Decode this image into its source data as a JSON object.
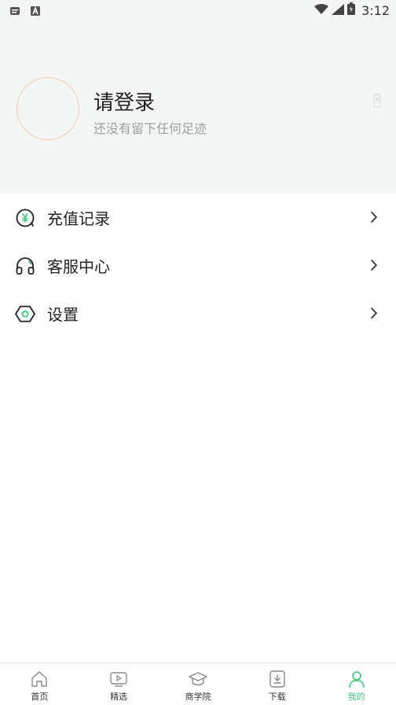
{
  "status_bar": {
    "time": "3:12",
    "left_icons": [
      "notification-icon",
      "a-icon"
    ],
    "right_icons": [
      "wifi-icon",
      "signal-icon",
      "battery-icon"
    ]
  },
  "profile": {
    "title": "请登录",
    "subtitle": "还没有留下任何足迹"
  },
  "menu": {
    "items": [
      {
        "label": "充值记录",
        "icon": "recharge-icon"
      },
      {
        "label": "客服中心",
        "icon": "headset-icon"
      },
      {
        "label": "设置",
        "icon": "settings-icon"
      }
    ]
  },
  "tabbar": {
    "active_color": "#3cc47a",
    "tabs": [
      {
        "label": "首页",
        "icon": "home-icon"
      },
      {
        "label": "精选",
        "icon": "video-icon"
      },
      {
        "label": "商学院",
        "icon": "graduation-cap-icon"
      },
      {
        "label": "下载",
        "icon": "download-icon"
      },
      {
        "label": "我的",
        "icon": "user-icon",
        "active": true
      }
    ]
  }
}
